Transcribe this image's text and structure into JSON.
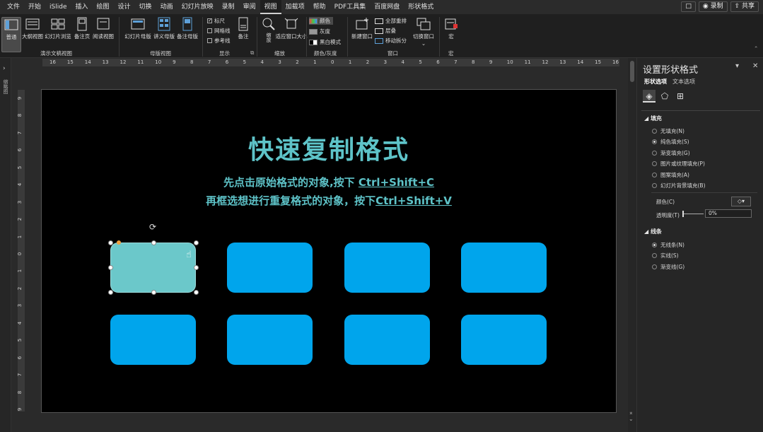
{
  "menubar": {
    "tabs": [
      "文件",
      "开始",
      "iSlide",
      "插入",
      "绘图",
      "设计",
      "切换",
      "动画",
      "幻灯片放映",
      "录制",
      "审阅",
      "视图",
      "加载项",
      "帮助",
      "PDF工具集",
      "百度网盘",
      "形状格式"
    ],
    "active_tab": "视图",
    "record_label": "◉ 录制",
    "share_label": "⇪ 共享"
  },
  "ribbon": {
    "views": {
      "normal": "普通",
      "outline": "大纲视图",
      "sorter": "幻灯片浏览",
      "notes_page": "备注页",
      "reading": "阅读视图",
      "group": "演示文稿视图"
    },
    "masters": {
      "slide_master": "幻灯片母版",
      "handout_master": "讲义母版",
      "notes_master": "备注母版",
      "group": "母版视图"
    },
    "show": {
      "ruler": "标尺",
      "gridlines": "网格线",
      "guides": "参考线",
      "notes": "备注",
      "group": "显示"
    },
    "zoom": {
      "zoom": "缩放",
      "fit": "适应窗口大小",
      "group": "缩放"
    },
    "color": {
      "color": "颜色",
      "grayscale": "灰度",
      "bw": "黑白模式",
      "group": "颜色/灰度"
    },
    "window": {
      "new_window": "新建窗口",
      "arrange_all": "全部重排",
      "cascade": "层叠",
      "move_split": "移动拆分",
      "switch": "切换窗口",
      "group": "窗口"
    },
    "macros": {
      "macro": "宏",
      "group": "宏"
    }
  },
  "thumbstrip": {
    "label": "缩略图"
  },
  "ruler": {
    "h_ticks": [
      "16",
      "15",
      "14",
      "13",
      "12",
      "11",
      "10",
      "9",
      "8",
      "7",
      "6",
      "5",
      "4",
      "3",
      "2",
      "1",
      "0",
      "1",
      "2",
      "3",
      "4",
      "5",
      "6",
      "7",
      "8",
      "9",
      "10",
      "11",
      "12",
      "13",
      "14",
      "15",
      "16"
    ],
    "v_ticks": [
      "9",
      "8",
      "7",
      "6",
      "5",
      "4",
      "3",
      "2",
      "1",
      "0",
      "1",
      "2",
      "3",
      "4",
      "5",
      "6",
      "7",
      "8",
      "9"
    ]
  },
  "slide": {
    "title": "快速复制格式",
    "line1_prefix": "先点击原始格式的对象,按下 ",
    "line1_key": "Ctrl+Shift+C",
    "line2_prefix": "再框选想进行重复格式的对象，按下",
    "line2_key": "Ctrl+Shift+V",
    "colors": {
      "teal": "#6bc8ca",
      "blue": "#00a5ec",
      "text": "#5ec3c8"
    }
  },
  "pane": {
    "title": "设置形状格式",
    "tab_shape": "形状选项",
    "tab_text": "文本选项",
    "fill_section": "填充",
    "fill_options": [
      "无填充(N)",
      "纯色填充(S)",
      "渐变填充(G)",
      "图片或纹理填充(P)",
      "图案填充(A)",
      "幻灯片背景填充(B)"
    ],
    "fill_selected": 1,
    "color_label": "颜色(C)",
    "transparency_label": "透明度(T)",
    "transparency_value": "0%",
    "line_section": "线条",
    "line_options": [
      "无线条(N)",
      "实线(S)",
      "渐变线(G)"
    ],
    "line_selected": 0
  }
}
